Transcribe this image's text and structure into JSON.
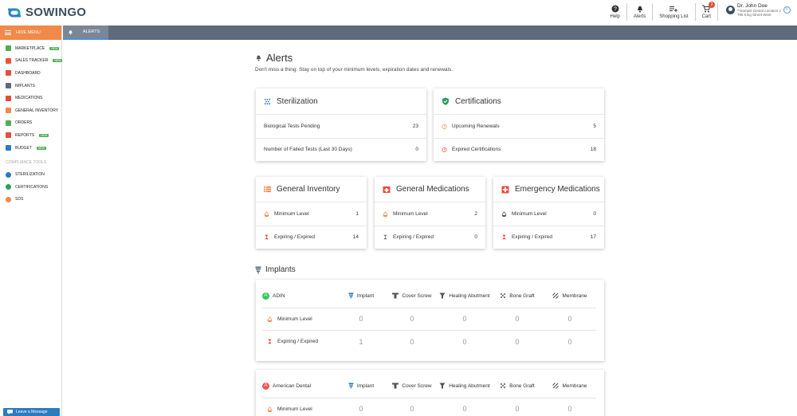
{
  "header": {
    "logo": "SOWINGO",
    "help": "Help",
    "alerts": "Alerts",
    "shopping_list": "Shopping List",
    "cart": "Cart",
    "cart_count": "2",
    "user_name": "Dr. John Doe",
    "location": "**Sample Dental Location 1",
    "address": "786 King Street West"
  },
  "sidebar": {
    "hide_menu": "HIDE MENU",
    "new_badge": "NEW",
    "items": [
      {
        "label": "MARKETPLACE",
        "new": true,
        "color": "#4cb050"
      },
      {
        "label": "SALES TRACKER",
        "new": true,
        "color": "#f0522f"
      },
      {
        "label": "DASHBOARD",
        "new": false,
        "color": "#e74c3c"
      },
      {
        "label": "IMPLANTS",
        "new": false,
        "color": "#5d6b7d"
      },
      {
        "label": "MEDICATIONS",
        "new": false,
        "color": "#e74c3c"
      },
      {
        "label": "GENERAL INVENTORY",
        "new": false,
        "color": "#f0894a"
      },
      {
        "label": "ORDERS",
        "new": false,
        "color": "#4cb050"
      },
      {
        "label": "REPORTS",
        "new": true,
        "color": "#e74c3c"
      },
      {
        "label": "BUDGET",
        "new": true,
        "color": "#2a7bc0"
      }
    ],
    "compliance_title": "COMPLIANCE TOOLS",
    "compliance_items": [
      {
        "label": "STERILIZATION",
        "color": "#2a7bc0"
      },
      {
        "label": "CERTIFICATIONS",
        "color": "#2e9e5c"
      },
      {
        "label": "SDS",
        "color": "#f0894a"
      }
    ],
    "leave_message": "Leave a Message"
  },
  "tabs": {
    "alerts": "ALERTS"
  },
  "page": {
    "title": "Alerts",
    "subtitle": "Don't miss a thing: Stay on top of your minimum levels, expiration dates and renewals."
  },
  "sterilization": {
    "title": "Sterilization",
    "rows": [
      {
        "label": "Biological Tests Pending",
        "value": "23"
      },
      {
        "label": "Number of Failed Tests (Last 30 Days)",
        "value": "0"
      }
    ]
  },
  "certifications": {
    "title": "Certifications",
    "rows": [
      {
        "label": "Upcoming Renewals",
        "value": "5"
      },
      {
        "label": "Expired Certifications",
        "value": "18"
      }
    ]
  },
  "general_inventory": {
    "title": "General Inventory",
    "rows": [
      {
        "label": "Minimum Level",
        "value": "1"
      },
      {
        "label": "Expiring / Expired",
        "value": "14"
      }
    ]
  },
  "general_medications": {
    "title": "General Medications",
    "rows": [
      {
        "label": "Minimum Level",
        "value": "2"
      },
      {
        "label": "Expiring / Expired",
        "value": "0"
      }
    ]
  },
  "emergency_medications": {
    "title": "Emergency Medications",
    "rows": [
      {
        "label": "Minimum Level",
        "value": "0"
      },
      {
        "label": "Expiring / Expired",
        "value": "17"
      }
    ]
  },
  "implants": {
    "title": "Implants",
    "columns": [
      "Implant",
      "Cover Screw",
      "Healing Abutment",
      "Bone Graft",
      "Membrane"
    ],
    "brands": [
      {
        "name": "ADIN",
        "letter": "A",
        "color": "#34c759",
        "rows": [
          {
            "label": "Minimum Level",
            "values": [
              "0",
              "0",
              "0",
              "0",
              "0"
            ]
          },
          {
            "label": "Expiring / Expired",
            "values": [
              "1",
              "0",
              "0",
              "0",
              "0"
            ]
          }
        ]
      },
      {
        "name": "American Dental",
        "letter": "A",
        "color": "#f05454",
        "rows": [
          {
            "label": "Minimum Level",
            "values": [
              "0",
              "0",
              "0",
              "0",
              "0"
            ]
          }
        ]
      }
    ]
  }
}
